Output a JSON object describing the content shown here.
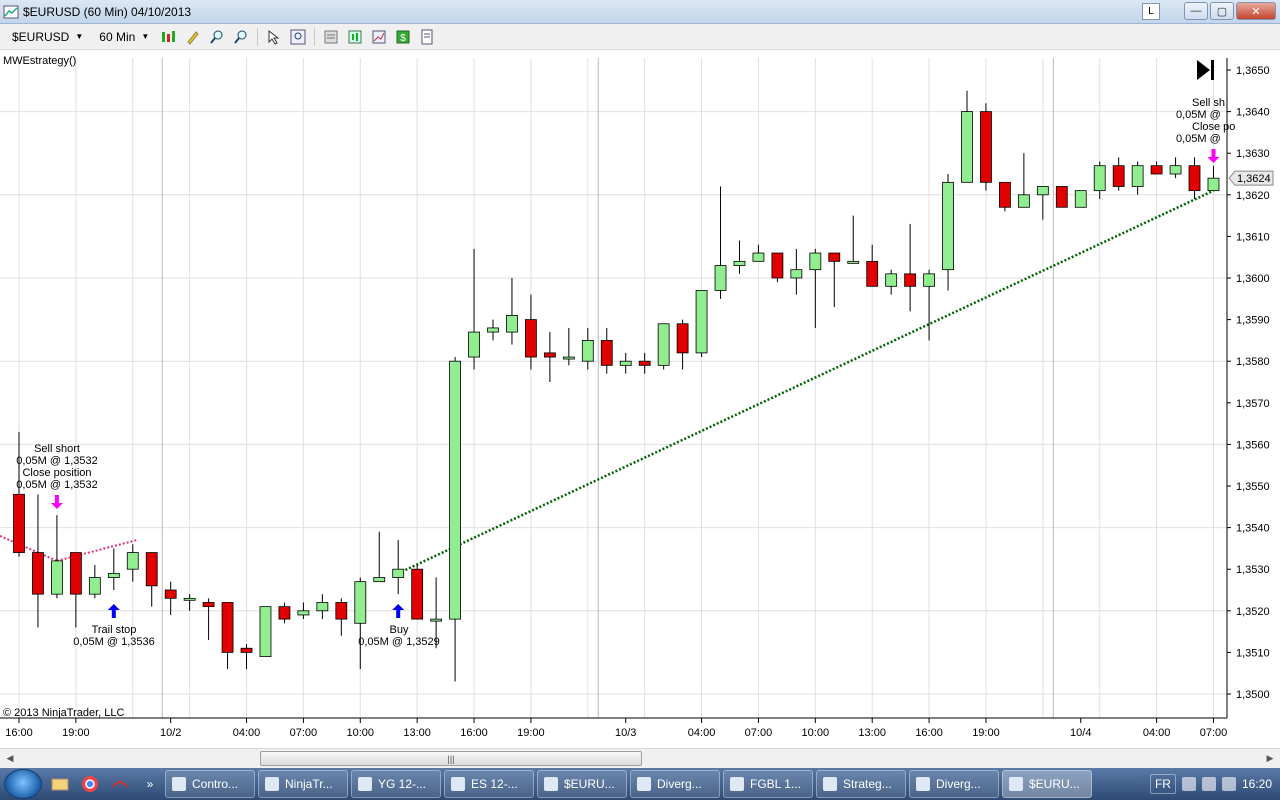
{
  "window": {
    "title": "$EURUSD (60 Min)  04/10/2013",
    "layout_button": "L",
    "minimize": "—",
    "maximize": "▢",
    "close": "✕"
  },
  "toolbar": {
    "instrument": "$EURUSD",
    "interval": "60 Min",
    "icons": [
      "bars-style-icon",
      "pencil-icon",
      "zoom-in-icon",
      "zoom-out-icon",
      "cursor-icon",
      "search-zoom-icon",
      "properties-icon",
      "data-box-icon",
      "chart-trader-icon",
      "dollar-icon",
      "template-icon"
    ]
  },
  "chart": {
    "strategy_label": "MWEstrategy()",
    "copyright": "© 2013 NinjaTrader, LLC",
    "last_price_label": "1,3624",
    "colors": {
      "up": "#90ee90",
      "down": "#e00000",
      "wick": "#000000",
      "grid": "#e0e0e0",
      "projection": "#006400",
      "sell_arrow": "#ff00ff",
      "buy_arrow": "#0000ff"
    }
  },
  "chart_data": {
    "type": "candlestick",
    "instrument": "$EURUSD",
    "interval": "60 Min",
    "y_axis": {
      "ticks": [
        "1,3650",
        "1,3640",
        "1,3630",
        "1,3620",
        "1,3610",
        "1,3600",
        "1,3590",
        "1,3580",
        "1,3570",
        "1,3560",
        "1,3550",
        "1,3540",
        "1,3530",
        "1,3520",
        "1,3510",
        "1,3500"
      ],
      "range": [
        1.3496,
        1.3654
      ]
    },
    "x_axis_labels": [
      "16:00",
      "19:00",
      "10/2",
      "04:00",
      "07:00",
      "10:00",
      "13:00",
      "16:00",
      "19:00",
      "10/3",
      "04:00",
      "07:00",
      "10:00",
      "13:00",
      "16:00",
      "19:00",
      "10/4",
      "04:00",
      "07:00"
    ],
    "candles": [
      {
        "o": 1.3548,
        "h": 1.3563,
        "l": 1.3533,
        "c": 1.3534
      },
      {
        "o": 1.3534,
        "h": 1.3548,
        "l": 1.3516,
        "c": 1.3524
      },
      {
        "o": 1.3524,
        "h": 1.3543,
        "l": 1.3523,
        "c": 1.3532
      },
      {
        "o": 1.3534,
        "h": 1.3534,
        "l": 1.3516,
        "c": 1.3524
      },
      {
        "o": 1.3524,
        "h": 1.3531,
        "l": 1.3523,
        "c": 1.3528
      },
      {
        "o": 1.3528,
        "h": 1.3535,
        "l": 1.3525,
        "c": 1.3529
      },
      {
        "o": 1.353,
        "h": 1.3536,
        "l": 1.3527,
        "c": 1.3534
      },
      {
        "o": 1.3534,
        "h": 1.3534,
        "l": 1.3521,
        "c": 1.3526
      },
      {
        "o": 1.3525,
        "h": 1.3527,
        "l": 1.3519,
        "c": 1.3523
      },
      {
        "o": 1.3523,
        "h": 1.3524,
        "l": 1.352,
        "c": 1.3523
      },
      {
        "o": 1.3522,
        "h": 1.3523,
        "l": 1.3513,
        "c": 1.3521
      },
      {
        "o": 1.3522,
        "h": 1.3522,
        "l": 1.3506,
        "c": 1.351
      },
      {
        "o": 1.3511,
        "h": 1.3512,
        "l": 1.3506,
        "c": 1.351
      },
      {
        "o": 1.3509,
        "h": 1.3521,
        "l": 1.3509,
        "c": 1.3521
      },
      {
        "o": 1.3521,
        "h": 1.3522,
        "l": 1.3517,
        "c": 1.3518
      },
      {
        "o": 1.3519,
        "h": 1.3522,
        "l": 1.3518,
        "c": 1.352
      },
      {
        "o": 1.352,
        "h": 1.3524,
        "l": 1.3518,
        "c": 1.3522
      },
      {
        "o": 1.3522,
        "h": 1.3523,
        "l": 1.3514,
        "c": 1.3518
      },
      {
        "o": 1.3517,
        "h": 1.3528,
        "l": 1.3506,
        "c": 1.3527
      },
      {
        "o": 1.3527,
        "h": 1.3539,
        "l": 1.3527,
        "c": 1.3528
      },
      {
        "o": 1.3528,
        "h": 1.3537,
        "l": 1.3524,
        "c": 1.353
      },
      {
        "o": 1.353,
        "h": 1.3531,
        "l": 1.3519,
        "c": 1.3518
      },
      {
        "o": 1.3518,
        "h": 1.3528,
        "l": 1.3511,
        "c": 1.3518
      },
      {
        "o": 1.3518,
        "h": 1.3581,
        "l": 1.3503,
        "c": 1.358
      },
      {
        "o": 1.3581,
        "h": 1.3607,
        "l": 1.3578,
        "c": 1.3587
      },
      {
        "o": 1.3587,
        "h": 1.359,
        "l": 1.3585,
        "c": 1.3588
      },
      {
        "o": 1.3587,
        "h": 1.36,
        "l": 1.3584,
        "c": 1.3591
      },
      {
        "o": 1.359,
        "h": 1.3596,
        "l": 1.3578,
        "c": 1.3581
      },
      {
        "o": 1.3582,
        "h": 1.3587,
        "l": 1.3575,
        "c": 1.3581
      },
      {
        "o": 1.3581,
        "h": 1.3588,
        "l": 1.3579,
        "c": 1.3581
      },
      {
        "o": 1.358,
        "h": 1.3588,
        "l": 1.3578,
        "c": 1.3585
      },
      {
        "o": 1.3585,
        "h": 1.3588,
        "l": 1.3577,
        "c": 1.3579
      },
      {
        "o": 1.3579,
        "h": 1.3582,
        "l": 1.3577,
        "c": 1.358
      },
      {
        "o": 1.358,
        "h": 1.3582,
        "l": 1.3577,
        "c": 1.3579
      },
      {
        "o": 1.3579,
        "h": 1.3589,
        "l": 1.3578,
        "c": 1.3589
      },
      {
        "o": 1.3589,
        "h": 1.359,
        "l": 1.3578,
        "c": 1.3582
      },
      {
        "o": 1.3582,
        "h": 1.3597,
        "l": 1.3581,
        "c": 1.3597
      },
      {
        "o": 1.3597,
        "h": 1.3622,
        "l": 1.3595,
        "c": 1.3603
      },
      {
        "o": 1.3603,
        "h": 1.3609,
        "l": 1.3601,
        "c": 1.3604
      },
      {
        "o": 1.3604,
        "h": 1.3608,
        "l": 1.3604,
        "c": 1.3606
      },
      {
        "o": 1.3606,
        "h": 1.3606,
        "l": 1.3599,
        "c": 1.36
      },
      {
        "o": 1.36,
        "h": 1.3607,
        "l": 1.3596,
        "c": 1.3602
      },
      {
        "o": 1.3602,
        "h": 1.3607,
        "l": 1.3588,
        "c": 1.3606
      },
      {
        "o": 1.3606,
        "h": 1.3606,
        "l": 1.3593,
        "c": 1.3604
      },
      {
        "o": 1.3604,
        "h": 1.3615,
        "l": 1.3604,
        "c": 1.3604
      },
      {
        "o": 1.3604,
        "h": 1.3608,
        "l": 1.3598,
        "c": 1.3598
      },
      {
        "o": 1.3598,
        "h": 1.3602,
        "l": 1.3596,
        "c": 1.3601
      },
      {
        "o": 1.3601,
        "h": 1.3613,
        "l": 1.3592,
        "c": 1.3598
      },
      {
        "o": 1.3598,
        "h": 1.3602,
        "l": 1.3585,
        "c": 1.3601
      },
      {
        "o": 1.3602,
        "h": 1.3625,
        "l": 1.3597,
        "c": 1.3623
      },
      {
        "o": 1.3623,
        "h": 1.3645,
        "l": 1.3623,
        "c": 1.364
      },
      {
        "o": 1.364,
        "h": 1.3642,
        "l": 1.3621,
        "c": 1.3623
      },
      {
        "o": 1.3623,
        "h": 1.3623,
        "l": 1.3616,
        "c": 1.3617
      },
      {
        "o": 1.3617,
        "h": 1.363,
        "l": 1.3617,
        "c": 1.362
      },
      {
        "o": 1.362,
        "h": 1.3622,
        "l": 1.3614,
        "c": 1.3622
      },
      {
        "o": 1.3622,
        "h": 1.3622,
        "l": 1.3617,
        "c": 1.3617
      },
      {
        "o": 1.3617,
        "h": 1.3621,
        "l": 1.3617,
        "c": 1.3621
      },
      {
        "o": 1.3621,
        "h": 1.3628,
        "l": 1.3619,
        "c": 1.3627
      },
      {
        "o": 1.3627,
        "h": 1.3629,
        "l": 1.3621,
        "c": 1.3622
      },
      {
        "o": 1.3622,
        "h": 1.3628,
        "l": 1.362,
        "c": 1.3627
      },
      {
        "o": 1.3627,
        "h": 1.3628,
        "l": 1.3625,
        "c": 1.3625
      },
      {
        "o": 1.3625,
        "h": 1.3629,
        "l": 1.3624,
        "c": 1.3627
      },
      {
        "o": 1.3627,
        "h": 1.3629,
        "l": 1.3619,
        "c": 1.3621
      },
      {
        "o": 1.3621,
        "h": 1.3627,
        "l": 1.3621,
        "c": 1.3624
      }
    ],
    "trades": [
      {
        "label": [
          "Sell short",
          "0,05M @ 1,3532",
          "Close position",
          "0,05M @ 1,3532"
        ],
        "side": "sell"
      },
      {
        "label": [
          "Trail stop",
          "0,05M @ 1,3536"
        ],
        "side": "buy"
      },
      {
        "label": [
          "Buy",
          "0,05M @ 1,3529"
        ],
        "side": "buy"
      },
      {
        "label": [
          "Sell sh",
          "0,05M @",
          "Close po",
          "0,05M @"
        ],
        "side": "sell"
      }
    ],
    "last_price": "1,3624",
    "grid": true
  },
  "scrollbar": {
    "thumb_grip": "|||",
    "left_arrow": "◀",
    "right_arrow": "▶"
  },
  "taskbar": {
    "items": [
      {
        "label": "Contro...",
        "active": false
      },
      {
        "label": "NinjaTr...",
        "active": false
      },
      {
        "label": "YG 12-...",
        "active": false
      },
      {
        "label": "ES 12-...",
        "active": false
      },
      {
        "label": "$EURU...",
        "active": false
      },
      {
        "label": "Diverg...",
        "active": false
      },
      {
        "label": "FGBL 1...",
        "active": false
      },
      {
        "label": "Strateg...",
        "active": false
      },
      {
        "label": "Diverg...",
        "active": false
      },
      {
        "label": "$EURU...",
        "active": true
      }
    ],
    "language": "FR",
    "clock": "16:20",
    "overflow": "»"
  }
}
